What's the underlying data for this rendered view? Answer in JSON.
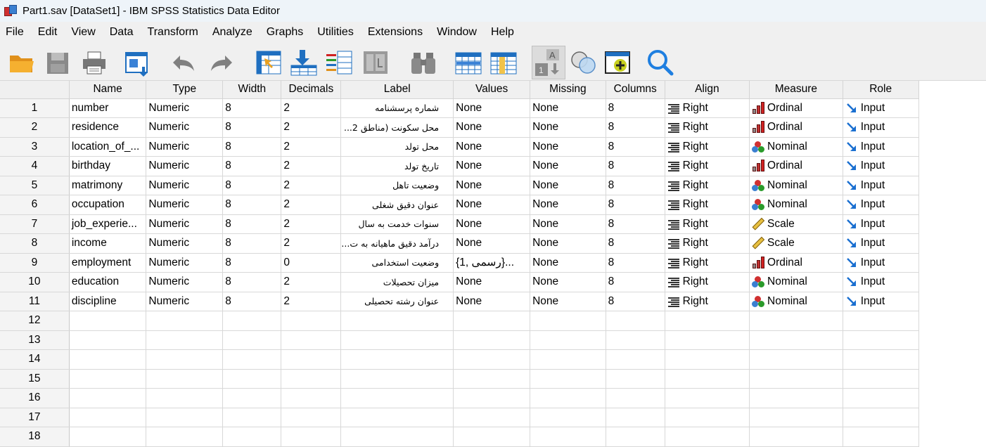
{
  "window": {
    "title": "Part1.sav [DataSet1] - IBM SPSS Statistics Data Editor"
  },
  "menu": [
    "File",
    "Edit",
    "View",
    "Data",
    "Transform",
    "Analyze",
    "Graphs",
    "Utilities",
    "Extensions",
    "Window",
    "Help"
  ],
  "columns": [
    "Name",
    "Type",
    "Width",
    "Decimals",
    "Label",
    "Values",
    "Missing",
    "Columns",
    "Align",
    "Measure",
    "Role"
  ],
  "rows": [
    {
      "n": "1",
      "name": "number",
      "type": "Numeric",
      "width": "8",
      "decimals": "2",
      "label": "شماره پرسشنامه",
      "values": "None",
      "missing": "None",
      "columns": "8",
      "align": "Right",
      "measure": "Ordinal",
      "role": "Input"
    },
    {
      "n": "2",
      "name": "residence",
      "type": "Numeric",
      "width": "8",
      "decimals": "2",
      "label": "محل سکونت (مناطق 2...",
      "values": "None",
      "missing": "None",
      "columns": "8",
      "align": "Right",
      "measure": "Ordinal",
      "role": "Input"
    },
    {
      "n": "3",
      "name": "location_of_...",
      "type": "Numeric",
      "width": "8",
      "decimals": "2",
      "label": "محل تولد",
      "values": "None",
      "missing": "None",
      "columns": "8",
      "align": "Right",
      "measure": "Nominal",
      "role": "Input"
    },
    {
      "n": "4",
      "name": "birthday",
      "type": "Numeric",
      "width": "8",
      "decimals": "2",
      "label": "تاریخ تولد",
      "values": "None",
      "missing": "None",
      "columns": "8",
      "align": "Right",
      "measure": "Ordinal",
      "role": "Input"
    },
    {
      "n": "5",
      "name": "matrimony",
      "type": "Numeric",
      "width": "8",
      "decimals": "2",
      "label": "وضعیت تاهل",
      "values": "None",
      "missing": "None",
      "columns": "8",
      "align": "Right",
      "measure": "Nominal",
      "role": "Input"
    },
    {
      "n": "6",
      "name": "occupation",
      "type": "Numeric",
      "width": "8",
      "decimals": "2",
      "label": "عنوان دقیق شغلی",
      "values": "None",
      "missing": "None",
      "columns": "8",
      "align": "Right",
      "measure": "Nominal",
      "role": "Input"
    },
    {
      "n": "7",
      "name": "job_experie...",
      "type": "Numeric",
      "width": "8",
      "decimals": "2",
      "label": "سنوات خدمت به سال",
      "values": "None",
      "missing": "None",
      "columns": "8",
      "align": "Right",
      "measure": "Scale",
      "role": "Input"
    },
    {
      "n": "8",
      "name": "income",
      "type": "Numeric",
      "width": "8",
      "decimals": "2",
      "label": "درآمد دقیق ماهیانه به ت...",
      "values": "None",
      "missing": "None",
      "columns": "8",
      "align": "Right",
      "measure": "Scale",
      "role": "Input"
    },
    {
      "n": "9",
      "name": "employment",
      "type": "Numeric",
      "width": "8",
      "decimals": "0",
      "label": "وضعیت استخدامی",
      "values": "{1, رسمی}...",
      "missing": "None",
      "columns": "8",
      "align": "Right",
      "measure": "Ordinal",
      "role": "Input"
    },
    {
      "n": "10",
      "name": "education",
      "type": "Numeric",
      "width": "8",
      "decimals": "2",
      "label": "میزان تحصیلات",
      "values": "None",
      "missing": "None",
      "columns": "8",
      "align": "Right",
      "measure": "Nominal",
      "role": "Input"
    },
    {
      "n": "11",
      "name": "discipline",
      "type": "Numeric",
      "width": "8",
      "decimals": "2",
      "label": "عنوان رشته تحصیلی",
      "values": "None",
      "missing": "None",
      "columns": "8",
      "align": "Right",
      "measure": "Nominal",
      "role": "Input"
    }
  ],
  "empty_rows": [
    "12",
    "13",
    "14",
    "15",
    "16",
    "17",
    "18"
  ],
  "colors": {
    "menu_bg": "#f0f0f0",
    "title_bg": "#eef4f9",
    "ordinal_red": "#d02020",
    "scale_yellow": "#e8c040",
    "role_blue": "#1a6fd0"
  },
  "toolbar_icons": [
    "open-folder-icon",
    "save-icon",
    "print-icon",
    "recall-dialog-icon",
    "undo-icon",
    "redo-icon",
    "goto-case-icon",
    "goto-variable-icon",
    "variables-icon",
    "run-descriptives-icon",
    "find-icon",
    "insert-cases-icon",
    "insert-variable-icon",
    "split-file-icon",
    "select-cases-icon",
    "value-labels-icon",
    "use-variable-sets-icon",
    "search-icon"
  ]
}
